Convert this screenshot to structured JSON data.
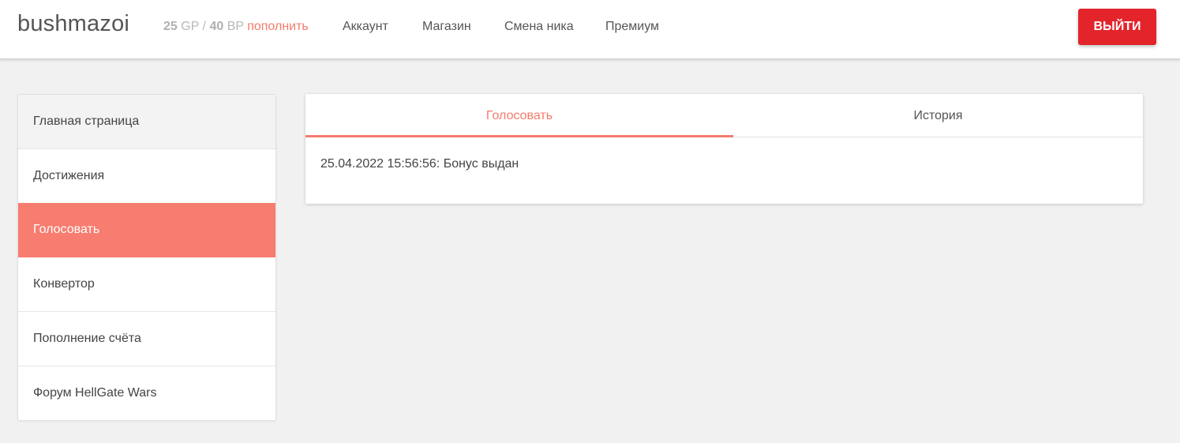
{
  "header": {
    "username": "bushmazoi",
    "gp_amount": "25",
    "gp_unit": "GP",
    "separator": "/",
    "bp_amount": "40",
    "bp_unit": "BP",
    "topup_label": "пополнить",
    "nav": [
      "Аккаунт",
      "Магазин",
      "Смена ника",
      "Премиум"
    ],
    "logout_label": "ВЫЙТИ"
  },
  "sidebar": {
    "items": [
      {
        "label": "Главная страница"
      },
      {
        "label": "Достижения"
      },
      {
        "label": "Голосовать"
      },
      {
        "label": "Конвертор"
      },
      {
        "label": "Пополнение счёта"
      },
      {
        "label": "Форум HellGate Wars"
      }
    ],
    "active_index": 2
  },
  "panel": {
    "tabs": [
      "Голосовать",
      "История"
    ],
    "active_tab": 0,
    "entries": [
      "25.04.2022 15:56:56: Бонус выдан"
    ]
  },
  "colors": {
    "accent": "#f47b6b",
    "active_item_bg": "#f77d70",
    "logout_bg": "#e3242b",
    "page_bg": "#f1f1f1"
  }
}
